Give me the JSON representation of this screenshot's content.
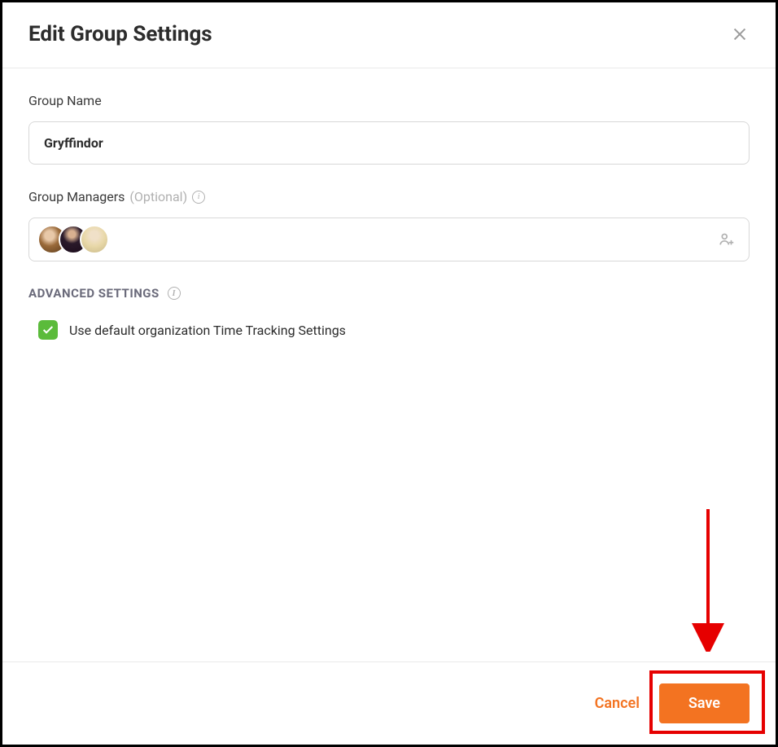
{
  "modal": {
    "title": "Edit Group Settings"
  },
  "form": {
    "group_name_label": "Group Name",
    "group_name_value": "Gryffindor",
    "managers_label": "Group Managers",
    "managers_optional": "(Optional)"
  },
  "advanced": {
    "section_label": "ADVANCED SETTINGS",
    "default_tracking_label": "Use default organization Time Tracking Settings",
    "default_tracking_checked": true
  },
  "footer": {
    "cancel_label": "Cancel",
    "save_label": "Save"
  }
}
